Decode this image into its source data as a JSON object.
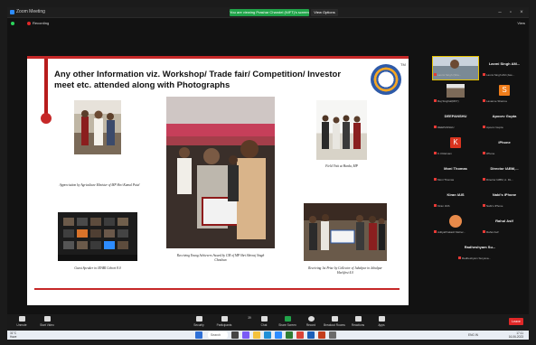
{
  "window": {
    "app_name": "Zoom Meeting",
    "share_banner": "You are viewing Prashar Chandel (NIFT)'s screen",
    "view_options": "View Options"
  },
  "top_strip": {
    "recording": "Recording",
    "view": "View"
  },
  "slide": {
    "title": "Any other Information viz. Workshop/ Trade fair/ Competition/ Investor meet etc. attended along with Photographs",
    "tm": "TM",
    "captions": {
      "agri": "Appreciation by Agriculture Minister of MP Shri Kamal Patel",
      "award": "Receiving Young Achievers Award by CM of MP Shri Shivraj Singh Chouhan",
      "field": "Field Visit at Harda, MP",
      "jrabi": "Guest Speaker in JRABI Cohort 8.0",
      "collector": "Receiving 1st Prize by Collector of Jabalpur in Jabalpur Hackfest 4.0"
    }
  },
  "participants": [
    {
      "name": "",
      "sub": "Laxmi Singh (Sha..."
    },
    {
      "name": "Laxmi Singh AM...",
      "sub": "Laxmi Singh AM (Jwe..."
    },
    {
      "name": "",
      "sub": "Raj Singhal(RRY)"
    },
    {
      "name": "",
      "sub": "Lavanne Sharma",
      "initial": "S"
    },
    {
      "name": "DEEPANSHU",
      "sub": "DEEPANSHU"
    },
    {
      "name": "Apoorv Gupta",
      "sub": "Apoorv Gupta"
    },
    {
      "name": "",
      "sub": "K.V.Ratnam",
      "initial": "K"
    },
    {
      "name": "iPhone",
      "sub": "iPhone"
    },
    {
      "name": "Moni Thomas",
      "sub": "Moni Thomas"
    },
    {
      "name": "Director IABM,...",
      "sub": "Director IABM, A. DL..."
    },
    {
      "name": "Kiran IAIS",
      "sub": "Kiran IAIS"
    },
    {
      "name": "Nabi's iPhone",
      "sub": "Nabi's iPhone"
    },
    {
      "name": "",
      "sub": "AdityaPrakash Meher..."
    },
    {
      "name": "Rahul Asif",
      "sub": "Rahul Asif"
    },
    {
      "name": "Radheshyam Su...",
      "sub": "Radheshyam Suryava..."
    }
  ],
  "toolbar": {
    "unmute": "Unmute",
    "start_video": "Start Video",
    "security": "Security",
    "participants": "Participants",
    "participants_count": "39",
    "chat": "Chat",
    "share_screen": "Share Screen",
    "record": "Record",
    "breakout": "Breakout Rooms",
    "reactions": "Reactions",
    "apps": "Apps",
    "leave": "Leave"
  },
  "taskbar": {
    "weather_temp": "31°C",
    "weather_desc": "Haze",
    "search": "Search",
    "lang": "ENG IN",
    "time": "17:11",
    "date": "16-06-2023"
  },
  "colors": {
    "accent_red": "#c62828",
    "zoom_blue": "#2d8cff",
    "share_green": "#21a44a"
  }
}
